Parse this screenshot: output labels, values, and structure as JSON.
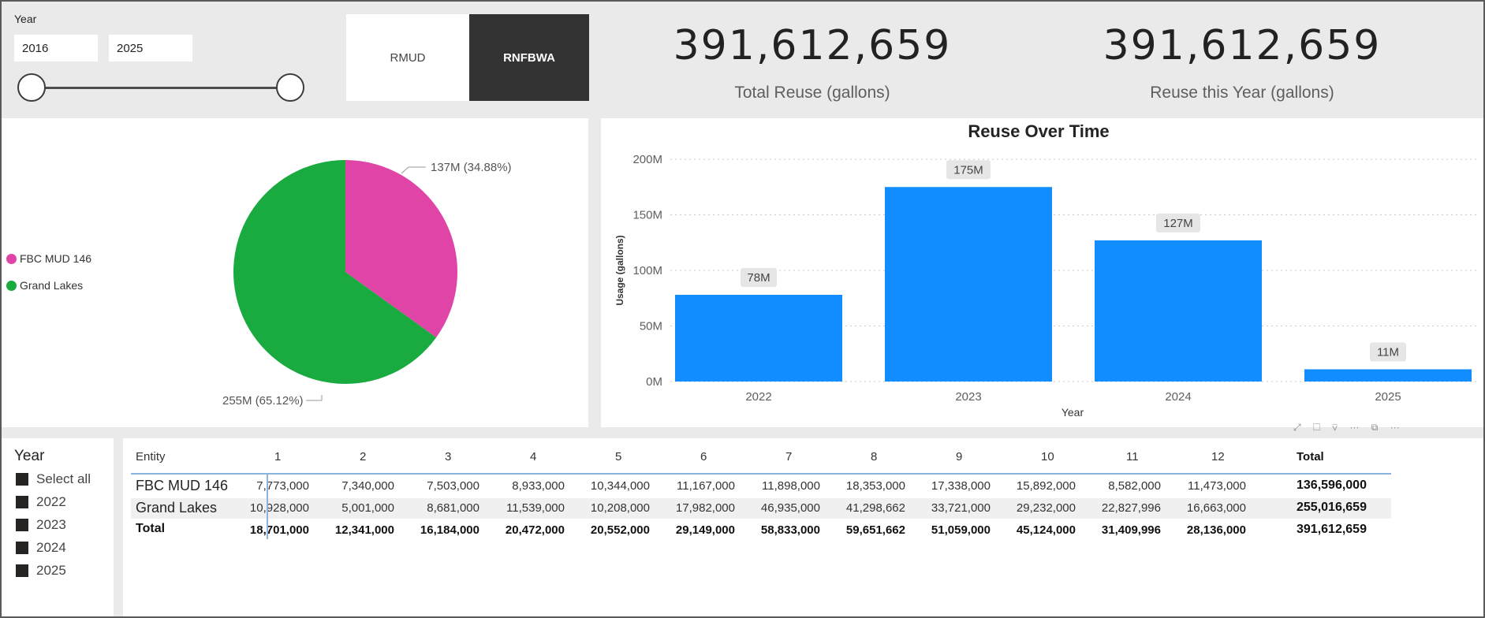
{
  "slicer_top": {
    "label": "Year",
    "start": "2016",
    "end": "2025"
  },
  "toggles": {
    "left": "RMUD",
    "right": "RNFBWA"
  },
  "cards": [
    {
      "value": "391,612,659",
      "label": "Total Reuse (gallons)"
    },
    {
      "value": "391,612,659",
      "label": "Reuse this Year (gallons)"
    }
  ],
  "colors": {
    "pink": "#e044a7",
    "green": "#1aab40",
    "bar": "#118dff"
  },
  "chart_data": [
    {
      "type": "pie",
      "slices": [
        {
          "name": "FBC MUD 146",
          "value": 137,
          "label": "137M (34.88%)",
          "percent": 34.88
        },
        {
          "name": "Grand Lakes",
          "value": 255,
          "label": "255M (65.12%)",
          "percent": 65.12
        }
      ],
      "legend": [
        "FBC MUD 146",
        "Grand Lakes"
      ]
    },
    {
      "type": "bar",
      "title": "Reuse Over Time",
      "xlabel": "Year",
      "ylabel": "Usage (gallons)",
      "categories": [
        "2022",
        "2023",
        "2024",
        "2025"
      ],
      "values": [
        78,
        175,
        127,
        11
      ],
      "data_labels": [
        "78M",
        "175M",
        "127M",
        "11M"
      ],
      "y_ticks": [
        "0M",
        "50M",
        "100M",
        "150M",
        "200M"
      ],
      "ylim": [
        0,
        200
      ],
      "grid": true
    }
  ],
  "slicer_bottom": {
    "title": "Year",
    "items": [
      "Select all",
      "2022",
      "2023",
      "2024",
      "2025"
    ]
  },
  "table": {
    "headers": [
      "Entity",
      "1",
      "2",
      "3",
      "4",
      "5",
      "6",
      "7",
      "8",
      "9",
      "10",
      "11",
      "12",
      "Total"
    ],
    "rows": [
      {
        "entity": "FBC MUD 146",
        "values": [
          "7,773,000",
          "7,340,000",
          "7,503,000",
          "8,933,000",
          "10,344,000",
          "11,167,000",
          "11,898,000",
          "18,353,000",
          "17,338,000",
          "15,892,000",
          "8,582,000",
          "11,473,000"
        ],
        "total": "136,596,000"
      },
      {
        "entity": "Grand Lakes",
        "values": [
          "10,928,000",
          "5,001,000",
          "8,681,000",
          "11,539,000",
          "10,208,000",
          "17,982,000",
          "46,935,000",
          "41,298,662",
          "33,721,000",
          "29,232,000",
          "22,827,996",
          "16,663,000"
        ],
        "total": "255,016,659"
      },
      {
        "entity": "Total",
        "values": [
          "18,701,000",
          "12,341,000",
          "16,184,000",
          "20,472,000",
          "20,552,000",
          "29,149,000",
          "58,833,000",
          "59,651,662",
          "51,059,000",
          "45,124,000",
          "31,409,996",
          "28,136,000"
        ],
        "total": "391,612,659"
      }
    ]
  }
}
